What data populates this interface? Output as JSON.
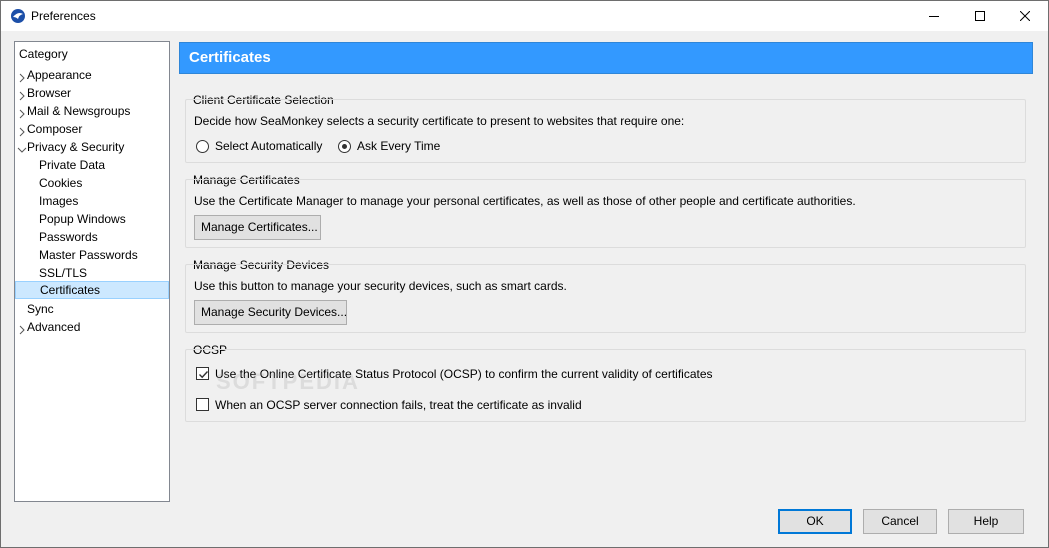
{
  "window": {
    "title": "Preferences",
    "minimize_icon": "minimize-icon",
    "maximize_icon": "maximize-icon",
    "close_icon": "close-icon"
  },
  "tree": {
    "header": "Category",
    "items": [
      {
        "label": "Appearance",
        "twisty": "collapsed"
      },
      {
        "label": "Browser",
        "twisty": "collapsed"
      },
      {
        "label": "Mail & Newsgroups",
        "twisty": "collapsed"
      },
      {
        "label": "Composer",
        "twisty": "collapsed"
      },
      {
        "label": "Privacy & Security",
        "twisty": "expanded"
      },
      {
        "label": "Private Data"
      },
      {
        "label": "Cookies"
      },
      {
        "label": "Images"
      },
      {
        "label": "Popup Windows"
      },
      {
        "label": "Passwords"
      },
      {
        "label": "Master Passwords"
      },
      {
        "label": "SSL/TLS"
      },
      {
        "label": "Certificates",
        "selected": true
      },
      {
        "label": "Sync"
      },
      {
        "label": "Advanced",
        "twisty": "collapsed"
      }
    ]
  },
  "banner": {
    "title": "Certificates"
  },
  "client_cert": {
    "title": "Client Certificate Selection",
    "description": "Decide how SeaMonkey selects a security certificate to present to websites that require one:",
    "option_auto": "Select Automatically",
    "option_ask": "Ask Every Time",
    "selected": "ask"
  },
  "manage_certs": {
    "title": "Manage Certificates",
    "description": "Use the Certificate Manager to manage your personal certificates, as well as those of other people and certificate authorities.",
    "button": "Manage Certificates..."
  },
  "security_devices": {
    "title": "Manage Security Devices",
    "description": "Use this button to manage your security devices, such as smart cards.",
    "button": "Manage Security Devices..."
  },
  "ocsp": {
    "title": "OCSP",
    "use_ocsp": "Use the Online Certificate Status Protocol (OCSP) to confirm the current validity of certificates",
    "use_ocsp_checked": true,
    "fail_invalid": "When an OCSP server connection fails, treat the certificate as invalid",
    "fail_invalid_checked": false
  },
  "footer": {
    "ok": "OK",
    "cancel": "Cancel",
    "help": "Help"
  },
  "watermark": "SOFTPEDIA",
  "colors": {
    "banner": "#3399ff",
    "selection": "#cce8ff"
  }
}
